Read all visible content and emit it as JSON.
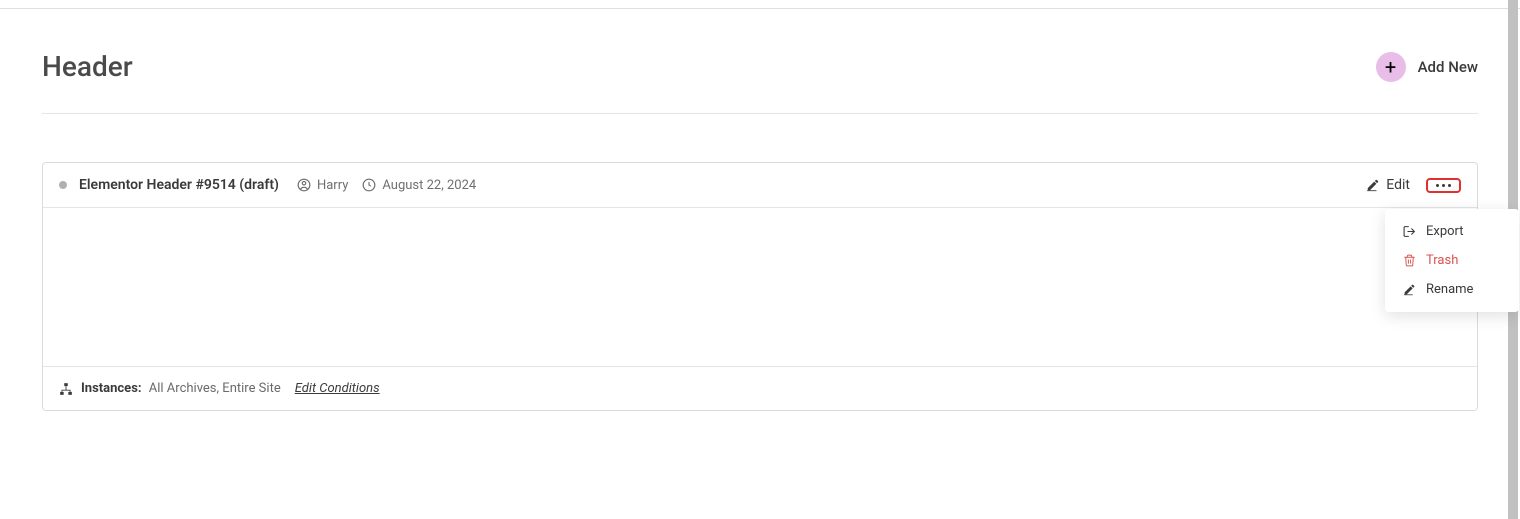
{
  "header": {
    "title": "Header",
    "add_new_label": "Add New"
  },
  "item": {
    "title": "Elementor Header #9514 (draft)",
    "author": "Harry",
    "date": "August 22, 2024",
    "edit_label": "Edit"
  },
  "footer": {
    "instances_label": "Instances:",
    "instances_value": "All Archives, Entire Site",
    "edit_conditions": "Edit Conditions"
  },
  "dropdown": {
    "export": "Export",
    "trash": "Trash",
    "rename": "Rename"
  }
}
